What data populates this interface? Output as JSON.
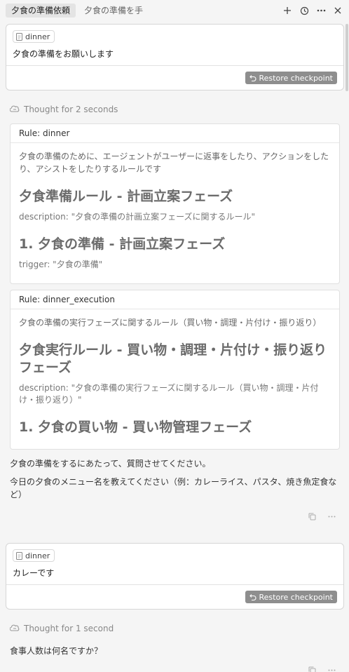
{
  "tabs": [
    {
      "label": "夕食の準備依頼",
      "active": true
    },
    {
      "label": "夕食の準備を手伝",
      "active": false
    }
  ],
  "toolbar": {
    "icons": [
      "plus-icon",
      "history-icon",
      "more-icon",
      "close-icon"
    ]
  },
  "messages": [
    {
      "chip": "dinner",
      "text": "夕食の準備をお願いします",
      "restore": "Restore checkpoint"
    },
    {
      "chip": "dinner",
      "text": "カレーです",
      "restore": "Restore checkpoint"
    }
  ],
  "thoughts": [
    "Thought for 2 seconds",
    "Thought for 1 second"
  ],
  "rules": [
    {
      "title": "Rule: dinner",
      "desc": "夕食の準備のために、エージェントがユーザーに返事をしたり、アクションをしたり、アシストをしたりするルールです",
      "h1": "夕食準備ルール - 計画立案フェーズ",
      "meta": "description: \"夕食の準備の計画立案フェーズに関するルール\"",
      "h2": "1. 夕食の準備 - 計画立案フェーズ",
      "trigger": "trigger: \"夕食の準備\""
    },
    {
      "title": "Rule: dinner_execution",
      "desc": "夕食の準備の実行フェーズに関するルール（買い物・調理・片付け・振り返り）",
      "h1": "夕食実行ルール - 買い物・調理・片付け・振り返りフェーズ",
      "meta": "description: \"夕食の準備の実行フェーズに関するルール（買い物・調理・片付け・振り返り）\"",
      "h2": "1. 夕食の買い物 - 買い物管理フェーズ"
    }
  ],
  "assistant": {
    "line1": "夕食の準備をするにあたって、質問させてください。",
    "line2": "今日の夕食のメニュー名を教えてください（例：カレーライス、パスタ、焼き魚定食など）",
    "line3": "食事人数は何名ですか？"
  }
}
